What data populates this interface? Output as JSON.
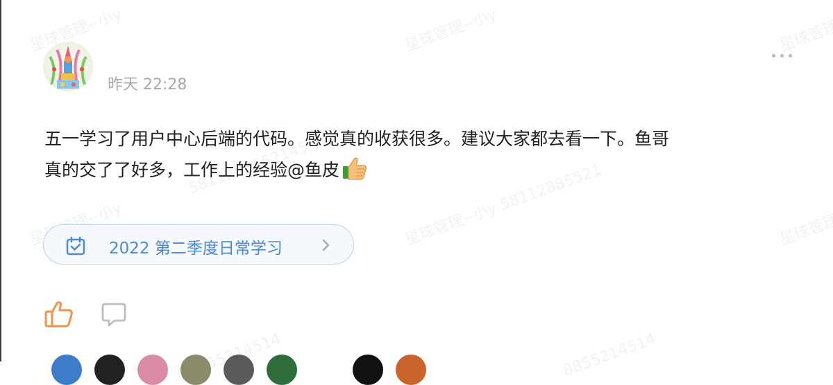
{
  "post": {
    "timestamp": "昨天 22:28",
    "text_line1": "五一学习了用户中心后端的代码。感觉真的收获很多。建议大家都去看一下。鱼哥",
    "text_line2": "真的交了了好多，工作上的经验@鱼皮"
  },
  "tag": {
    "label": "2022 第二季度日常学习",
    "icon": "calendar-check-icon"
  },
  "actions": {
    "like_icon": "thumbs-up-icon",
    "comment_icon": "comment-icon",
    "more_icon": "more-dots-icon"
  },
  "watermark": {
    "text1": "星球管理--小y",
    "text2": "5811288552145",
    "text3": "星球管理--小y 58112885521",
    "text4": "8855214514"
  },
  "colors": {
    "accent_blue": "#4a8ad4",
    "like_orange": "#f0924a",
    "tag_border": "#b8d3f1",
    "timestamp_gray": "#a8a8a8"
  }
}
